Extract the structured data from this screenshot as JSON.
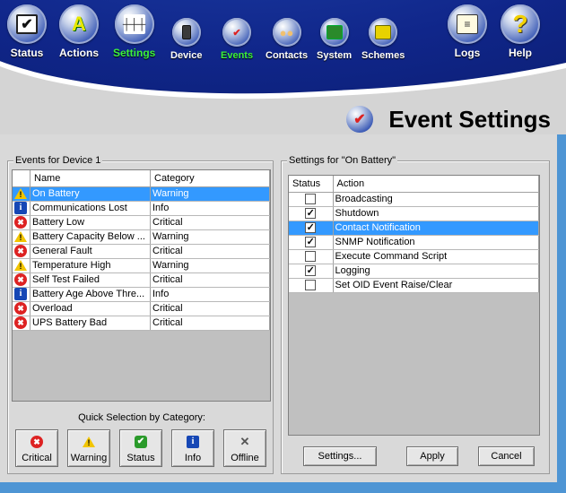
{
  "nav": {
    "items": [
      {
        "label": "Status",
        "icon": "status-check-icon"
      },
      {
        "label": "Actions",
        "icon": "actions-a-icon"
      },
      {
        "label": "Settings",
        "icon": "settings-sliders-icon"
      },
      {
        "label": "Device",
        "icon": "device-battery-icon"
      },
      {
        "label": "Events",
        "icon": "events-check-icon"
      },
      {
        "label": "Contacts",
        "icon": "contacts-people-icon"
      },
      {
        "label": "System",
        "icon": "system-monitor-icon"
      },
      {
        "label": "Schemes",
        "icon": "schemes-house-icon"
      },
      {
        "label": "Logs",
        "icon": "logs-notepad-icon"
      },
      {
        "label": "Help",
        "icon": "help-question-icon"
      }
    ],
    "active_color": "#3cf03c"
  },
  "page_title": "Event Settings",
  "events_group": {
    "title": "Events for Device 1",
    "columns": [
      "Name",
      "Category"
    ],
    "rows": [
      {
        "icon": "warning",
        "name": "On Battery",
        "category": "Warning",
        "selected": true
      },
      {
        "icon": "info",
        "name": "Communications Lost",
        "category": "Info"
      },
      {
        "icon": "critical",
        "name": "Battery Low",
        "category": "Critical"
      },
      {
        "icon": "warning",
        "name": "Battery Capacity Below ...",
        "category": "Warning"
      },
      {
        "icon": "critical",
        "name": "General Fault",
        "category": "Critical"
      },
      {
        "icon": "warning",
        "name": "Temperature High",
        "category": "Warning"
      },
      {
        "icon": "critical",
        "name": "Self Test Failed",
        "category": "Critical"
      },
      {
        "icon": "info",
        "name": "Battery Age Above Thre...",
        "category": "Info"
      },
      {
        "icon": "critical",
        "name": "Overload",
        "category": "Critical"
      },
      {
        "icon": "critical",
        "name": "UPS Battery Bad",
        "category": "Critical"
      }
    ]
  },
  "quick_selection": {
    "title": "Quick Selection by Category:",
    "buttons": [
      {
        "label": "Critical",
        "icon": "critical"
      },
      {
        "label": "Warning",
        "icon": "warning"
      },
      {
        "label": "Status",
        "icon": "status"
      },
      {
        "label": "Info",
        "icon": "info"
      },
      {
        "label": "Offline",
        "icon": "offline"
      }
    ]
  },
  "settings_group": {
    "title": "Settings for \"On Battery\"",
    "columns": [
      "Status",
      "Action"
    ],
    "rows": [
      {
        "checked": false,
        "action": "Broadcasting"
      },
      {
        "checked": true,
        "action": "Shutdown"
      },
      {
        "checked": true,
        "action": "Contact Notification",
        "selected": true
      },
      {
        "checked": true,
        "action": "SNMP Notification"
      },
      {
        "checked": false,
        "action": "Execute Command Script"
      },
      {
        "checked": true,
        "action": "Logging"
      },
      {
        "checked": false,
        "action": "Set OID Event Raise/Clear"
      }
    ],
    "buttons": {
      "settings": "Settings...",
      "apply": "Apply",
      "cancel": "Cancel"
    }
  },
  "colors": {
    "selection": "#3399ff",
    "header_blue": "#10268a",
    "frame_blue": "#4e95d4"
  }
}
